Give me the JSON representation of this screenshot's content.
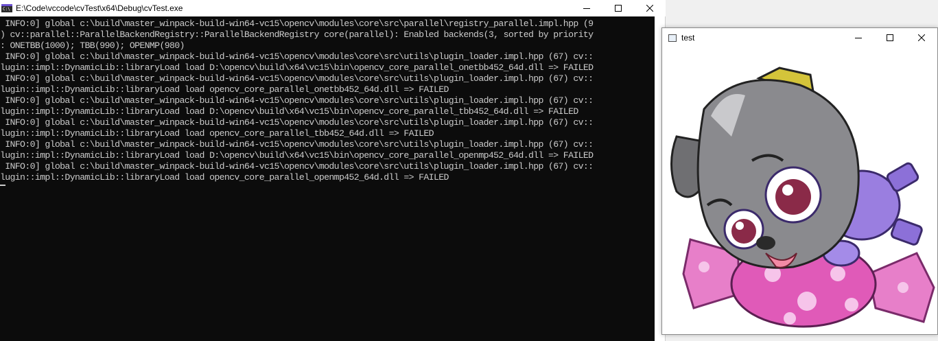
{
  "console": {
    "title": "E:\\Code\\vccode\\cvTest\\x64\\Debug\\cvTest.exe",
    "lines": [
      " INFO:0] global c:\\build\\master_winpack-build-win64-vc15\\opencv\\modules\\core\\src\\parallel\\registry_parallel.impl.hpp (9",
      ") cv::parallel::ParallelBackendRegistry::ParallelBackendRegistry core(parallel): Enabled backends(3, sorted by priority",
      ": ONETBB(1000); TBB(990); OPENMP(980)",
      " INFO:0] global c:\\build\\master_winpack-build-win64-vc15\\opencv\\modules\\core\\src\\utils\\plugin_loader.impl.hpp (67) cv::",
      "lugin::impl::DynamicLib::libraryLoad load D:\\opencv\\build\\x64\\vc15\\bin\\opencv_core_parallel_onetbb452_64d.dll => FAILED",
      " INFO:0] global c:\\build\\master_winpack-build-win64-vc15\\opencv\\modules\\core\\src\\utils\\plugin_loader.impl.hpp (67) cv::",
      "lugin::impl::DynamicLib::libraryLoad load opencv_core_parallel_onetbb452_64d.dll => FAILED",
      " INFO:0] global c:\\build\\master_winpack-build-win64-vc15\\opencv\\modules\\core\\src\\utils\\plugin_loader.impl.hpp (67) cv::",
      "lugin::impl::DynamicLib::libraryLoad load D:\\opencv\\build\\x64\\vc15\\bin\\opencv_core_parallel_tbb452_64d.dll => FAILED",
      " INFO:0] global c:\\build\\master_winpack-build-win64-vc15\\opencv\\modules\\core\\src\\utils\\plugin_loader.impl.hpp (67) cv::",
      "lugin::impl::DynamicLib::libraryLoad load opencv_core_parallel_tbb452_64d.dll => FAILED",
      " INFO:0] global c:\\build\\master_winpack-build-win64-vc15\\opencv\\modules\\core\\src\\utils\\plugin_loader.impl.hpp (67) cv::",
      "lugin::impl::DynamicLib::libraryLoad load D:\\opencv\\build\\x64\\vc15\\bin\\opencv_core_parallel_openmp452_64d.dll => FAILED",
      " INFO:0] global c:\\build\\master_winpack-build-win64-vc15\\opencv\\modules\\core\\src\\utils\\plugin_loader.impl.hpp (67) cv::",
      "lugin::impl::DynamicLib::libraryLoad load opencv_core_parallel_openmp452_64d.dll => FAILED"
    ],
    "icon": "console-icon",
    "colors": {
      "background": "#0c0c0c",
      "text": "#cccccc",
      "titlebar": "#ffffff"
    }
  },
  "image_window": {
    "title": "test",
    "icon": "window-icon",
    "content": "cartoon-dog-on-candy-image"
  },
  "window_controls": {
    "minimize": "minimize-icon",
    "maximize": "maximize-icon",
    "close": "close-icon"
  }
}
